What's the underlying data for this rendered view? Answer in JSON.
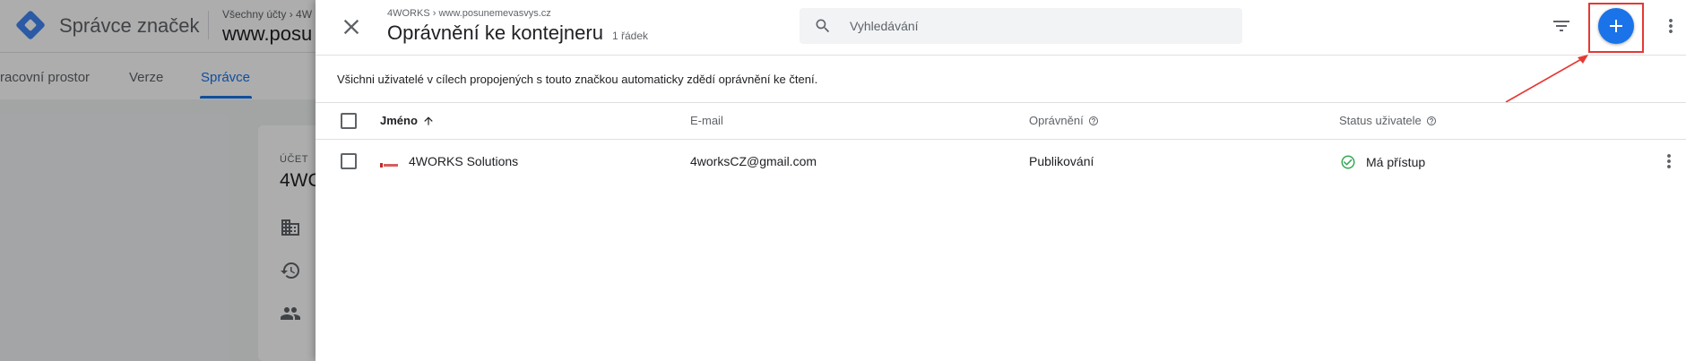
{
  "background": {
    "product_name": "Správce značek",
    "breadcrumb": "Všechny účty › 4W",
    "container_name": "www.posu",
    "nav": {
      "workspace": "racovní prostor",
      "versions": "Verze",
      "admin": "Správce"
    },
    "card": {
      "label": "ÚČET",
      "title": "4WC"
    }
  },
  "panel": {
    "breadcrumb": "4WORKS › www.posunemevasvys.cz",
    "title": "Oprávnění ke kontejneru",
    "row_count": "1 řádek",
    "search": {
      "placeholder": "Vyhledávání"
    },
    "info_text": "Všichni uživatelé v cílech propojených s touto značkou automaticky zdědí oprávnění ke čtení.",
    "icons": {
      "close": "close-icon",
      "search": "search-icon",
      "filter": "filter-icon",
      "add": "add-icon",
      "more": "more-vert-icon"
    },
    "colors": {
      "accent": "#1a73e8",
      "annotation": "#e53935",
      "status_ok": "#34a853"
    }
  },
  "table": {
    "columns": {
      "name": "Jméno",
      "email": "E-mail",
      "permission": "Oprávnění",
      "status": "Status uživatele"
    },
    "rows": [
      {
        "name": "4WORKS Solutions",
        "email": "4worksCZ@gmail.com",
        "permission": "Publikování",
        "status": "Má přístup"
      }
    ]
  }
}
